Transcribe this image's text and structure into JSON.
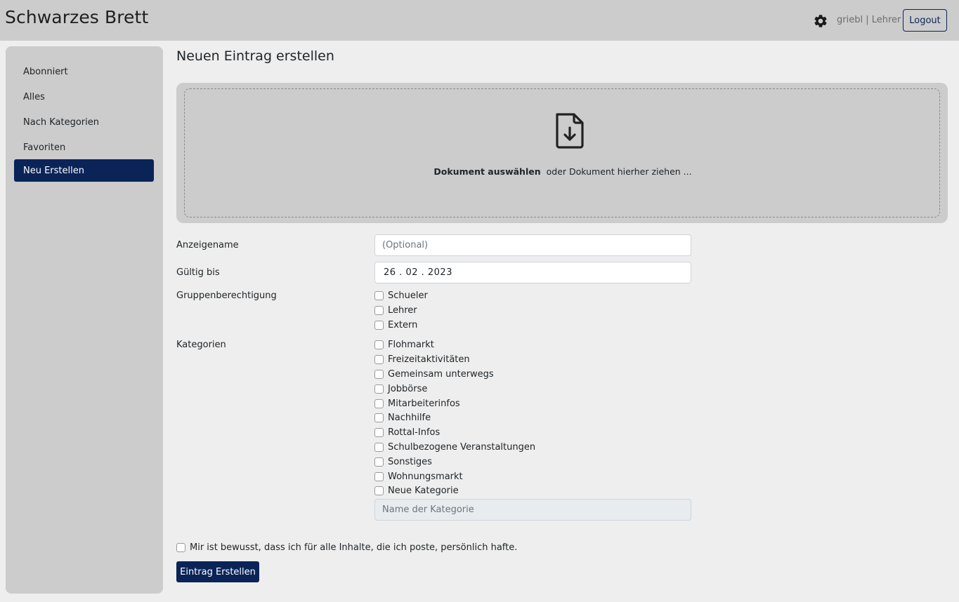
{
  "header": {
    "app_title": "Schwarzes Brett",
    "settings_icon": "gear-icon",
    "user_label": "griebl | Lehrer",
    "logout_label": "Logout"
  },
  "sidebar": {
    "items": [
      {
        "label": "Abonniert",
        "active": false
      },
      {
        "label": "Alles",
        "active": false
      },
      {
        "label": "Nach Kategorien",
        "active": false
      },
      {
        "label": "Favoriten",
        "active": false
      },
      {
        "label": "Neu Erstellen",
        "active": true
      }
    ]
  },
  "main": {
    "page_title": "Neuen Eintrag erstellen",
    "dropzone": {
      "icon": "file-download-icon",
      "select_label": "Dokument auswählen",
      "drag_text": "oder Dokument hierher ziehen ..."
    },
    "form": {
      "display_name": {
        "label": "Anzeigename",
        "placeholder": "(Optional)",
        "value": ""
      },
      "valid_until": {
        "label": "Gültig bis",
        "value": "26 . 02 . 2023"
      },
      "group_permission": {
        "label": "Gruppenberechtigung",
        "options": [
          "Schueler",
          "Lehrer",
          "Extern"
        ]
      },
      "categories": {
        "label": "Kategorien",
        "options": [
          "Flohmarkt",
          "Freizeitaktivitäten",
          "Gemeinsam unterwegs",
          "Jobbörse",
          "Mitarbeiterinfos",
          "Nachhilfe",
          "Rottal-Infos",
          "Schulbezogene Veranstaltungen",
          "Sonstiges",
          "Wohnungsmarkt",
          "Neue Kategorie"
        ],
        "new_category_placeholder": "Name der Kategorie"
      },
      "terms_label": "Mir ist bewusst, dass ich für alle Inhalte, die ich poste, persönlich hafte.",
      "submit_label": "Eintrag Erstellen"
    }
  },
  "colors": {
    "accent": "#0a2458",
    "header_bg": "#cccccc",
    "page_bg": "#eeeeee"
  }
}
